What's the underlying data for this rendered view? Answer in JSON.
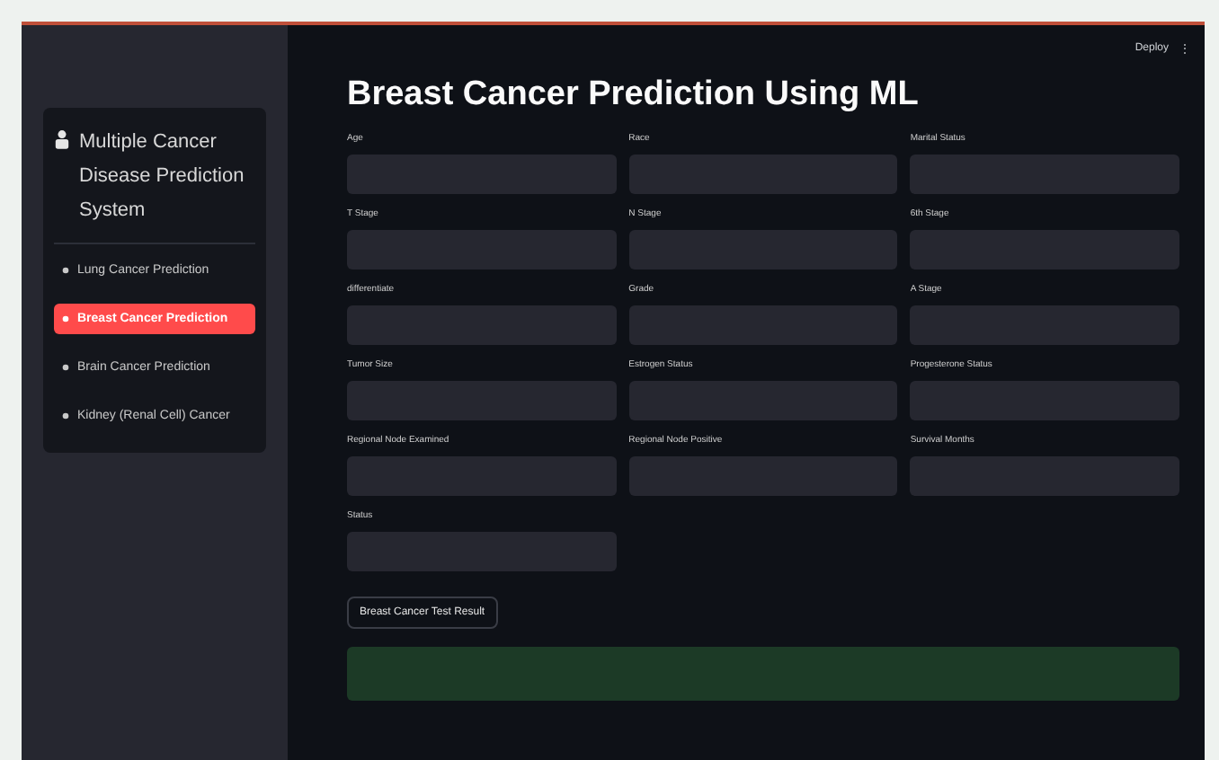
{
  "header": {
    "deploy": "Deploy",
    "menu": "⋮"
  },
  "sidebar": {
    "title": "Multiple Cancer Disease Prediction System",
    "items": [
      {
        "label": "Lung Cancer Prediction",
        "selected": false
      },
      {
        "label": "Breast Cancer Prediction",
        "selected": true
      },
      {
        "label": "Brain Cancer Prediction",
        "selected": false
      },
      {
        "label": "Kidney (Renal Cell) Cancer",
        "selected": false
      }
    ]
  },
  "main": {
    "title": "Breast Cancer Prediction Using ML",
    "fields": [
      {
        "label": "Age"
      },
      {
        "label": "Race"
      },
      {
        "label": "Marital Status"
      },
      {
        "label": "T Stage"
      },
      {
        "label": "N Stage"
      },
      {
        "label": "6th Stage"
      },
      {
        "label": "differentiate"
      },
      {
        "label": "Grade"
      },
      {
        "label": "A Stage"
      },
      {
        "label": "Tumor Size"
      },
      {
        "label": "Estrogen Status"
      },
      {
        "label": "Progesterone Status"
      },
      {
        "label": "Regional Node Examined"
      },
      {
        "label": "Regional Node Positive"
      },
      {
        "label": "Survival Months"
      },
      {
        "label": "Status"
      }
    ],
    "button": "Breast Cancer Test Result"
  }
}
